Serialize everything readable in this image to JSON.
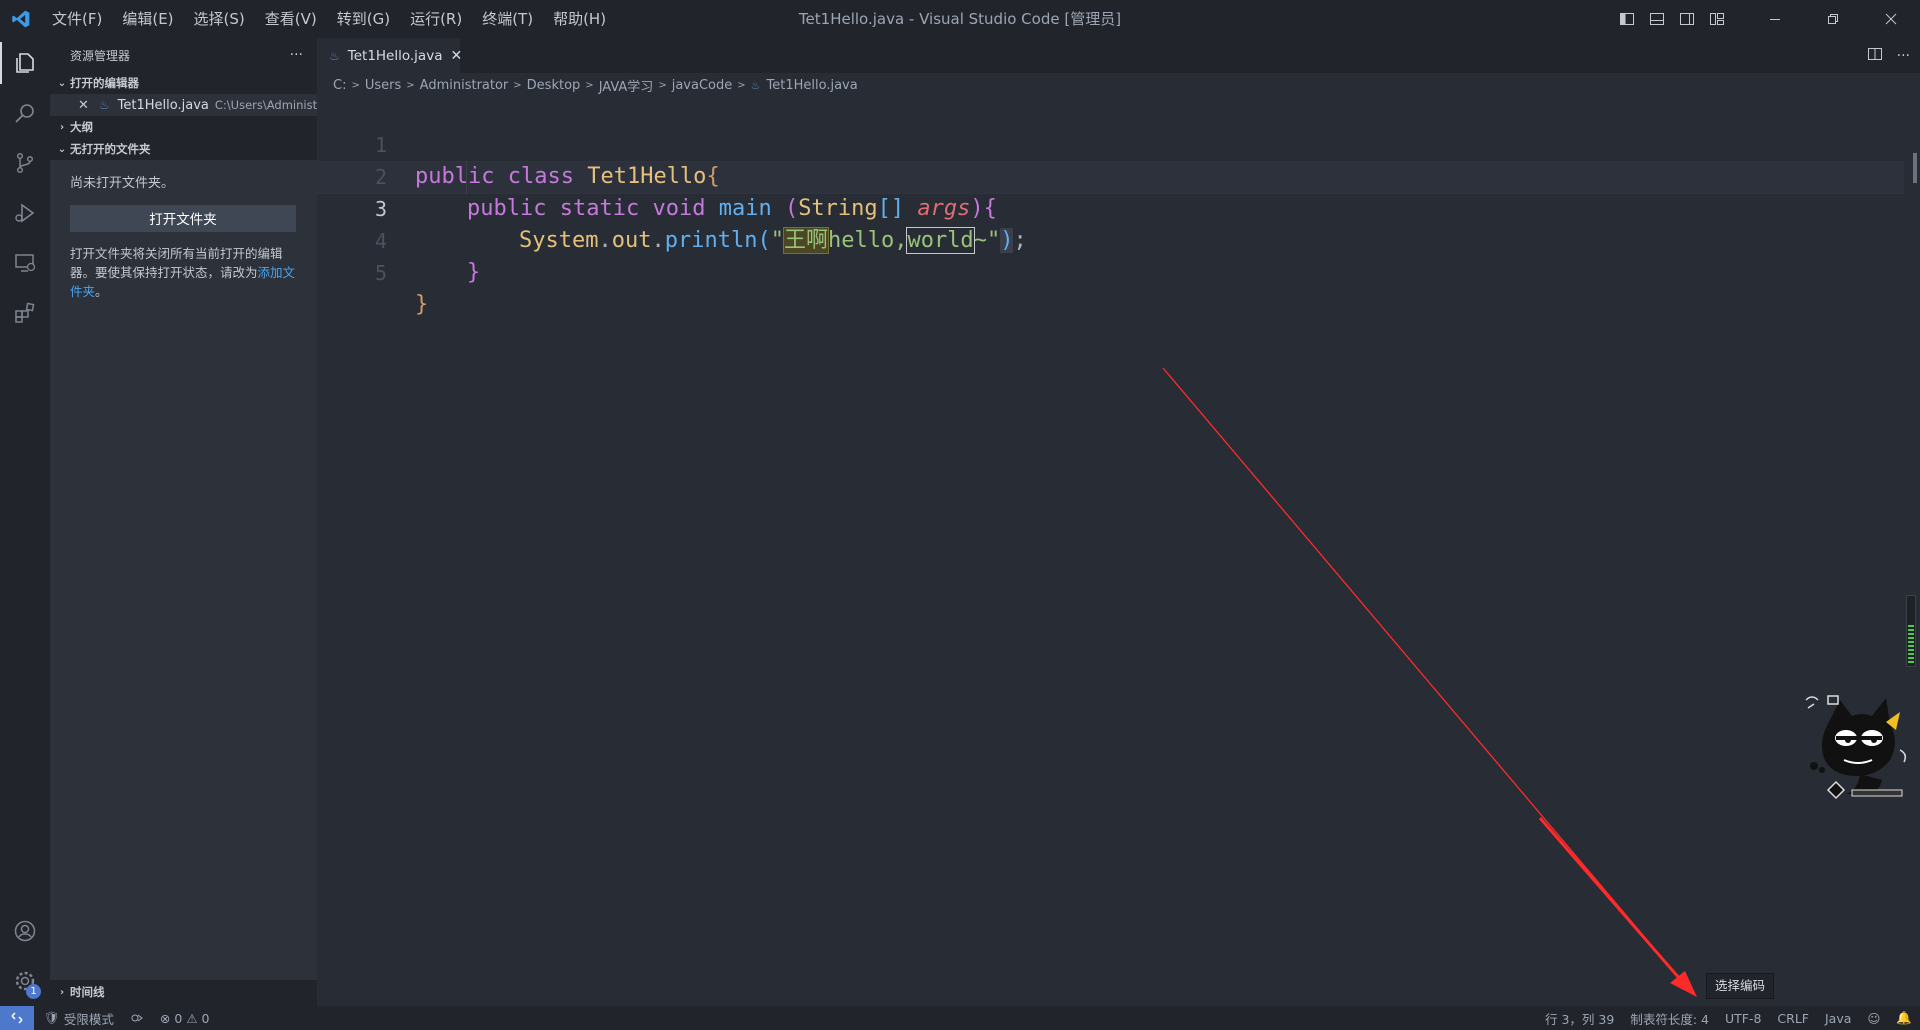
{
  "window": {
    "title": "Tet1Hello.java - Visual Studio Code [管理员]"
  },
  "menu": [
    "文件(F)",
    "编辑(E)",
    "选择(S)",
    "查看(V)",
    "转到(G)",
    "运行(R)",
    "终端(T)",
    "帮助(H)"
  ],
  "sidebar": {
    "header": "资源管理器",
    "more": "···",
    "open_editors_title": "打开的编辑器",
    "open_editor": {
      "name": "Tet1Hello.java",
      "path": "C:\\Users\\Administr..."
    },
    "outline_title": "大纲",
    "no_folder_title": "无打开的文件夹",
    "no_folder_text": "尚未打开文件夹。",
    "open_folder_button": "打开文件夹",
    "note_text": "打开文件夹将关闭所有当前打开的编辑器。要使其保持打开状态，请改为",
    "add_folder_link": "添加文件夹",
    "note_end": "。",
    "timeline_title": "时间线"
  },
  "tab": {
    "label": "Tet1Hello.java"
  },
  "breadcrumb": [
    "C:",
    "Users",
    "Administrator",
    "Desktop",
    "JAVA学习",
    "javaCode",
    "Tet1Hello.java"
  ],
  "editor": {
    "line_numbers": [
      "1",
      "2",
      "3",
      "4",
      "5"
    ],
    "line1": {
      "kw1": "public",
      "kw2": "class",
      "name": "Tet1Hello",
      "brace": "{"
    },
    "line2": {
      "kw1": "public",
      "kw2": "static",
      "kw3": "void",
      "fn": "main",
      "open": "(",
      "type": "String",
      "arr": "[]",
      "arg": "args",
      "close": ")",
      "brace": "{"
    },
    "line3": {
      "sys": "System",
      "dot1": ".",
      "out": "out",
      "dot2": ".",
      "fn": "println",
      "open": "(",
      "q1": "\"",
      "s1": "王啊",
      "s2": "hello,",
      "s3": "world",
      "s4": "~",
      "q2": "\"",
      "close": ")",
      "semi": ";"
    },
    "line4": {
      "brace": "}"
    },
    "line5": {
      "brace": "}"
    }
  },
  "tooltip": "选择编码",
  "activity_badge": "1",
  "statusbar": {
    "restricted": "受限模式",
    "errors": "0",
    "warnings": "0",
    "position": "行 3，列 39",
    "tab_size": "制表符长度: 4",
    "encoding": "UTF-8",
    "eol": "CRLF",
    "language": "Java"
  },
  "colors": {
    "accent": "#4d78cc",
    "arrow": "#ff2a2a",
    "background": "#282c34"
  }
}
